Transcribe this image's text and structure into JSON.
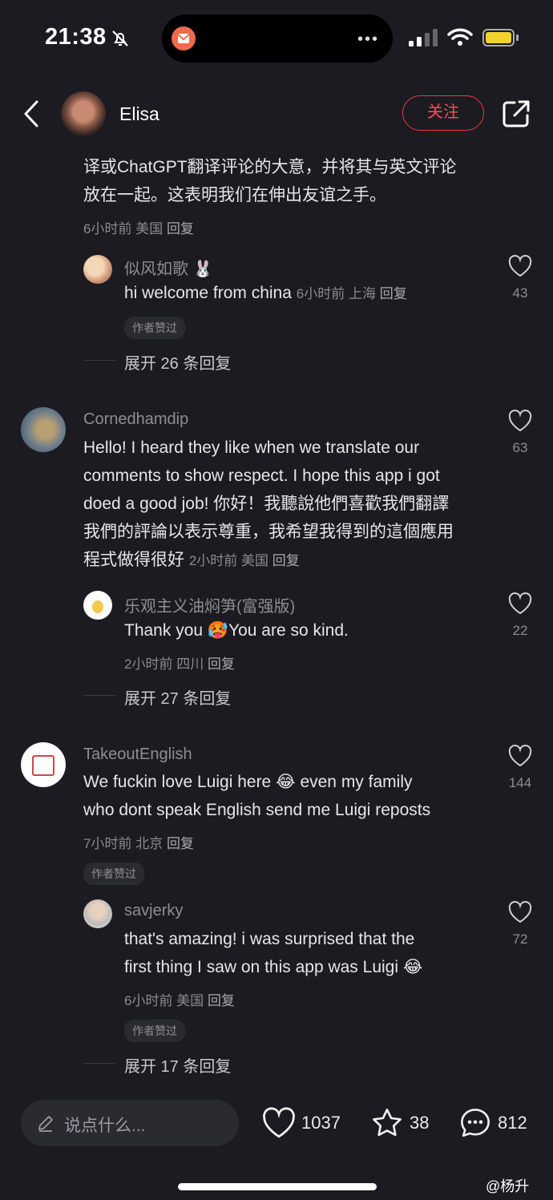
{
  "status": {
    "time": "21:38"
  },
  "header": {
    "name": "Elisa",
    "follow": "关注"
  },
  "post_tail": {
    "line1": "译或ChatGPT翻译评论的大意，并将其与英文评论",
    "line2": "放在一起。这表明我们在伸出友谊之手。",
    "time": "6小时前",
    "loc": "美国",
    "reply": "回复"
  },
  "c1_reply": {
    "user": "似风如歌 🐰",
    "text": "hi welcome from china",
    "time": "6小时前",
    "loc": "上海",
    "reply": "回复",
    "badge": "作者赞过",
    "likes": "43",
    "expand": "展开 26 条回复"
  },
  "c2": {
    "user": "Cornedhamdip",
    "line1": "Hello! I heard they like when we translate our",
    "line2": "comments to show respect. I hope this app i got",
    "line3": "doed a good job! 你好！我聽說他們喜歡我們翻譯",
    "line4": "我們的評論以表示尊重，我希望我得到的這個應用",
    "line5": "程式做得很好",
    "time": "2小时前",
    "loc": "美国",
    "reply": "回复",
    "likes": "63"
  },
  "c2_reply": {
    "user": "乐观主义油焖笋(富强版)",
    "text": "Thank you 🥵You are so kind.",
    "time": "2小时前",
    "loc": "四川",
    "reply": "回复",
    "likes": "22",
    "expand": "展开 27 条回复"
  },
  "c3": {
    "user": "TakeoutEnglish",
    "line1": "We fuckin love Luigi here 😂 even my family",
    "line2": "who dont speak English send me Luigi reposts",
    "time": "7小时前",
    "loc": "北京",
    "reply": "回复",
    "badge": "作者赞过",
    "likes": "144"
  },
  "c3_reply": {
    "user": "savjerky",
    "line1": "that's amazing! i was surprised that the",
    "line2": "first thing I saw on this app was Luigi 😂",
    "time": "6小时前",
    "loc": "美国",
    "reply": "回复",
    "badge": "作者赞过",
    "likes": "72",
    "expand": "展开 17 条回复"
  },
  "bottom": {
    "placeholder": "说点什么...",
    "likes": "1037",
    "favorites": "38",
    "comments": "812"
  },
  "watermark": "@杨升",
  "colors": {
    "bg": "#1c1b21",
    "follow": "#fe4a5f",
    "battery": "#f2d22e"
  }
}
